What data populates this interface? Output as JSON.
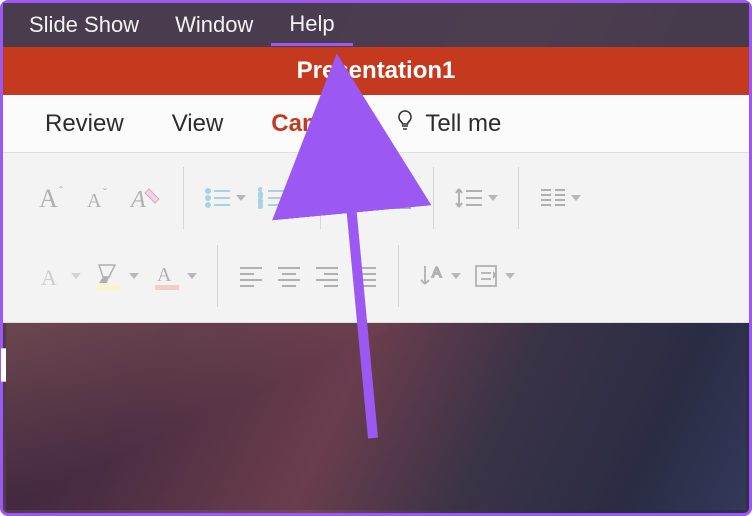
{
  "menubar": {
    "items": [
      "Slide Show",
      "Window",
      "Help"
    ],
    "active_index": 2
  },
  "titlebar": {
    "title": "Presentation1"
  },
  "tabs": {
    "items": [
      "Review",
      "View",
      "Camera"
    ],
    "active_index": 2,
    "tellme_label": "Tell me"
  },
  "ribbon_icons": {
    "row1": [
      "font-size-up",
      "font-size-down",
      "clear-format",
      "bullets",
      "numbering",
      "indent-decrease",
      "indent-increase",
      "line-spacing",
      "columns"
    ],
    "row2": [
      "font-stub",
      "highlight",
      "font-color",
      "align-left",
      "align-center",
      "align-right",
      "align-justify",
      "text-direction",
      "wrap-text"
    ],
    "highlight_color": "#fffb8f",
    "font_color": "#f49a94"
  },
  "annotation": {
    "color": "#9b58f3"
  }
}
